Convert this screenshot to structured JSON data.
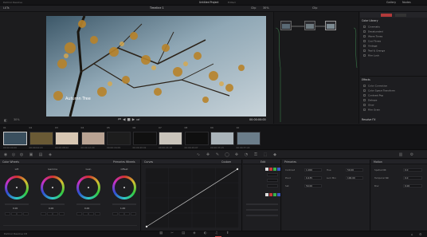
{
  "app": {
    "title": "DaVinci Resolve",
    "project": "Untitled Project",
    "status": "Edited"
  },
  "toolbar": {
    "gallery": "Gallery",
    "luts": "LUTs",
    "timecode_left": "Timeline",
    "clip": "Clip",
    "zoom": "30%",
    "lightbox": "Lightbox",
    "nodes": "Nodes"
  },
  "viewer": {
    "title": "Timeline 1",
    "overlay_text": "Autumn Tree",
    "timecode": "00:00:00:00"
  },
  "clips": [
    {
      "num": "01",
      "tc": "00:00:00:00",
      "color": "#3a4f5e"
    },
    {
      "num": "02",
      "tc": "00:00:04:13",
      "color": "#6a5a35"
    },
    {
      "num": "03",
      "tc": "00:00:08:02",
      "color": "#d8c7b3"
    },
    {
      "num": "04",
      "tc": "00:00:12:20",
      "color": "#b9a393"
    },
    {
      "num": "05",
      "tc": "00:00:16:09",
      "color": "#1d1d1d"
    },
    {
      "num": "06",
      "tc": "00:00:20:01",
      "color": "#101010"
    },
    {
      "num": "07",
      "tc": "00:00:24:18",
      "color": "#c9c4bb"
    },
    {
      "num": "08",
      "tc": "00:00:29:07",
      "color": "#0f0f0f"
    },
    {
      "num": "09",
      "tc": "00:00:33:15",
      "color": "#aab4ba"
    },
    {
      "num": "10",
      "tc": "00:00:37:22",
      "color": "#6b7d8a"
    }
  ],
  "library": {
    "section1": "Color Library",
    "items1": [
      "Cinematic",
      "Desaturated",
      "Warm Tones",
      "Cool Tones",
      "Vintage",
      "Teal & Orange",
      "Film Look"
    ],
    "section2": "Effects",
    "items2": [
      "Color Correction",
      "Color Space Transform",
      "Contrast Pop",
      "Dehaze",
      "Glow",
      "Film Grain"
    ],
    "section3": "Resolve FX"
  },
  "wheels": {
    "title": "Color Wheels",
    "mode": "Primaries Wheels",
    "labels": [
      "Lift",
      "Gamma",
      "Gain",
      "Offset"
    ],
    "values": [
      "0.00",
      "0.00",
      "0.00",
      "1.00"
    ]
  },
  "curves": {
    "title": "Curves",
    "subtitle": "Custom",
    "edit": "Edit"
  },
  "qualifier": {
    "title": "Primaries",
    "labels": [
      "Contrast",
      "Pivot",
      "Sat",
      "Hue",
      "Lum Mix"
    ],
    "values": [
      "1.000",
      "0.435",
      "50.00",
      "50.00",
      "100.00"
    ]
  },
  "mix": {
    "title": "Motion",
    "labels": [
      "Spatial NR",
      "Temporal NR",
      "Blur"
    ],
    "values": [
      "0.0",
      "0.0",
      "0.00"
    ]
  },
  "status": {
    "app_name": "DaVinci Resolve 18"
  }
}
